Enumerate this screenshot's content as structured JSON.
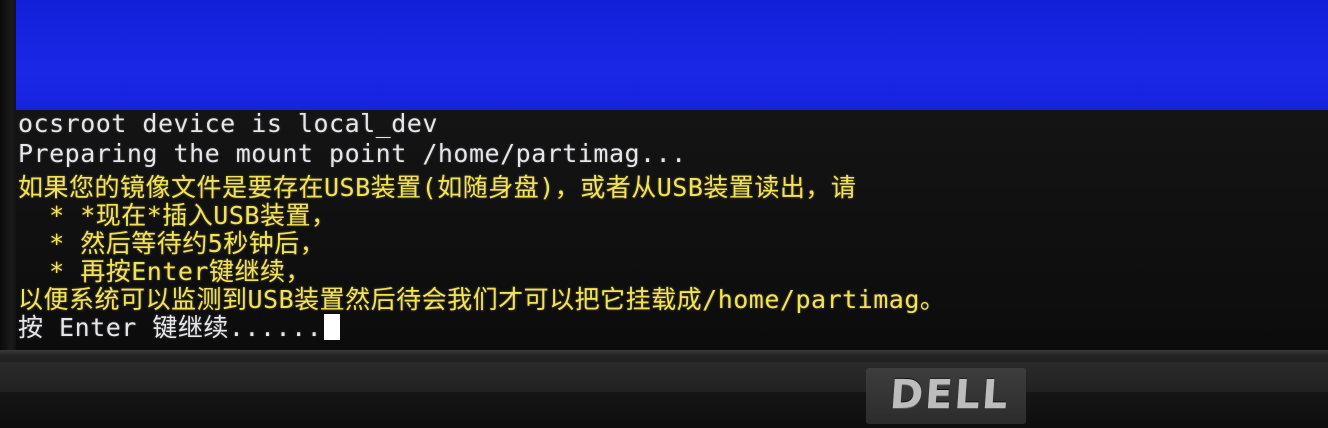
{
  "terminal": {
    "lines": [
      {
        "text": "ocsroot device is local_dev",
        "color": "#e6e6ea"
      },
      {
        "text": "Preparing the mount point /home/partimag...",
        "color": "#e6e6ea"
      },
      {
        "text": "如果您的镜像文件是要存在USB装置(如随身盘)，或者从USB装置读出，请",
        "color": "#f2e25a"
      },
      {
        "text": "  * *现在*插入USB装置，",
        "color": "#f2e25a"
      },
      {
        "text": "  * 然后等待约5秒钟后，",
        "color": "#f2e25a"
      },
      {
        "text": "  * 再按Enter键继续，",
        "color": "#f2e25a"
      },
      {
        "text": "以便系统可以监测到USB装置然后待会我们才可以把它挂载成/home/partimag。",
        "color": "#f2e25a"
      },
      {
        "text": "按 Enter 键继续......",
        "color": "#e6e6ea"
      }
    ]
  },
  "monitor": {
    "brand_logo": "DELL",
    "screen_background_color": "#1a28e6",
    "terminal_background_color": "#101010"
  }
}
